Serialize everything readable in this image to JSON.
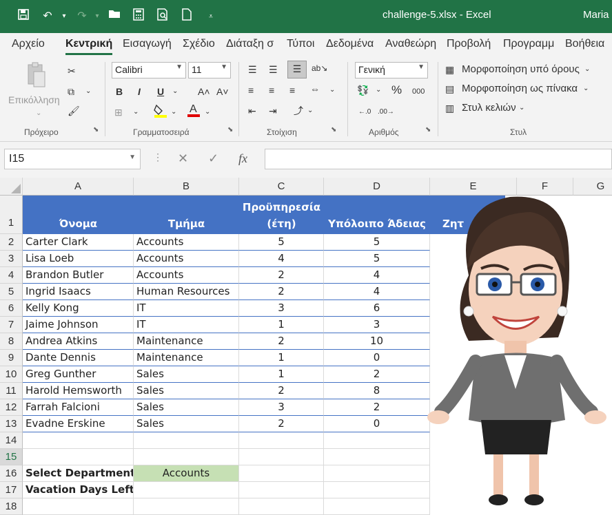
{
  "titlebar": {
    "title": "challenge-5.xlsx  -  Excel",
    "user": "Maria"
  },
  "tabs": [
    "Αρχείο",
    "Κεντρική",
    "Εισαγωγή",
    "Σχέδιο",
    "Διάταξη σ",
    "Τύποι",
    "Δεδομένα",
    "Αναθεώρη",
    "Προβολή",
    "Προγραμμ",
    "Βοήθεια"
  ],
  "ribbon": {
    "clipboard": {
      "paste_label": "Επικόλληση",
      "group": "Πρόχειρο"
    },
    "font": {
      "name": "Calibri",
      "size": "11",
      "group": "Γραμματοσειρά"
    },
    "alignment": {
      "group": "Στοίχιση"
    },
    "number": {
      "format": "Γενική",
      "group": "Αριθμός",
      "percent": "%",
      "thousands": "000"
    },
    "styles": {
      "conditional": "Μορφοποίηση υπό όρους",
      "as_table": "Μορφοποίηση ως πίνακα",
      "cell_styles": "Στυλ κελιών",
      "group": "Στυλ"
    }
  },
  "formula_bar": {
    "name_box": "I15",
    "fx": "fx",
    "content": ""
  },
  "columns": [
    "A",
    "B",
    "C",
    "D",
    "E",
    "F",
    "G"
  ],
  "table": {
    "headers": {
      "name": "Όνομα",
      "department": "Τμήμα",
      "seniority_1": "Προϋπηρεσία",
      "seniority_2": "(έτη)",
      "leave": "Υπόλοιπο Άδειας",
      "e_partial": "Ζητ"
    },
    "rows": [
      {
        "name": "Carter Clark",
        "dept": "Accounts",
        "years": "5",
        "leave": "5"
      },
      {
        "name": "Lisa Loeb",
        "dept": "Accounts",
        "years": "4",
        "leave": "5"
      },
      {
        "name": "Brandon Butler",
        "dept": "Accounts",
        "years": "2",
        "leave": "4"
      },
      {
        "name": "Ingrid Isaacs",
        "dept": "Human Resources",
        "years": "2",
        "leave": "4"
      },
      {
        "name": "Kelly Kong",
        "dept": "IT",
        "years": "3",
        "leave": "6"
      },
      {
        "name": "Jaime Johnson",
        "dept": "IT",
        "years": "1",
        "leave": "3"
      },
      {
        "name": "Andrea Atkins",
        "dept": "Maintenance",
        "years": "2",
        "leave": "10"
      },
      {
        "name": "Dante Dennis",
        "dept": "Maintenance",
        "years": "1",
        "leave": "0"
      },
      {
        "name": "Greg Gunther",
        "dept": "Sales",
        "years": "1",
        "leave": "2"
      },
      {
        "name": "Harold Hemsworth",
        "dept": "Sales",
        "years": "2",
        "leave": "8"
      },
      {
        "name": "Farrah Falcioni",
        "dept": "Sales",
        "years": "3",
        "leave": "2"
      },
      {
        "name": "Evadne Erskine",
        "dept": "Sales",
        "years": "2",
        "leave": "0"
      }
    ]
  },
  "row_numbers": [
    "1",
    "2",
    "3",
    "4",
    "5",
    "6",
    "7",
    "8",
    "9",
    "10",
    "11",
    "12",
    "13",
    "14",
    "15",
    "16",
    "17",
    "18"
  ],
  "inputs": {
    "select_label": "Select Department:",
    "select_value": "Accounts",
    "vacation_label": "Vacation Days Left:",
    "vacation_value": ""
  },
  "colors": {
    "excel_green": "#217346",
    "table_header": "#4472c4",
    "input_cell": "#c6e0b4"
  }
}
